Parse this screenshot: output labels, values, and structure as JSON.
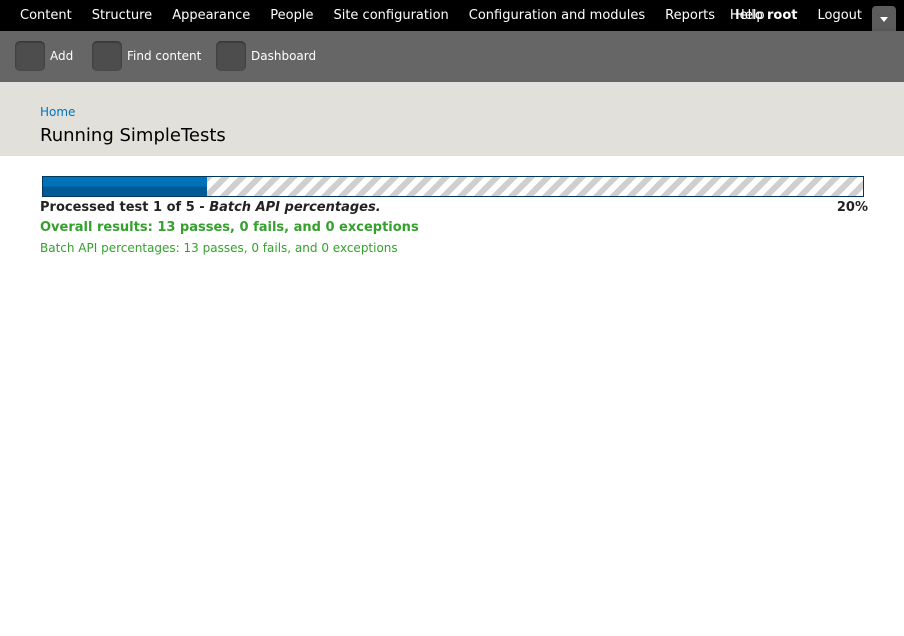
{
  "toolbar": {
    "nav": [
      "Content",
      "Structure",
      "Appearance",
      "People",
      "Site configuration",
      "Configuration and modules",
      "Reports",
      "Help"
    ],
    "hello": "Hello",
    "username": "root",
    "logout": "Logout"
  },
  "shortcuts": [
    {
      "label": "Add"
    },
    {
      "label": "Find content"
    },
    {
      "label": "Dashboard"
    }
  ],
  "breadcrumb": "Home",
  "page_title": "Running SimpleTests",
  "progress": {
    "percent": 20,
    "percent_label": "20%",
    "message_prefix": "Processed test 1 of 5 - ",
    "message_test": "Batch API percentages.",
    "overall": "Overall results: 13 passes, 0 fails, and 0 exceptions",
    "detail": "Batch API percentages: 13 passes, 0 fails, and 0 exceptions"
  },
  "colors": {
    "toolbar_bg": "#000000",
    "shortcuts_bg": "#666666",
    "header_bg": "#e1e0da",
    "link": "#0074bd",
    "progress_fill": "#0072b9",
    "pass": "#34a12d"
  }
}
